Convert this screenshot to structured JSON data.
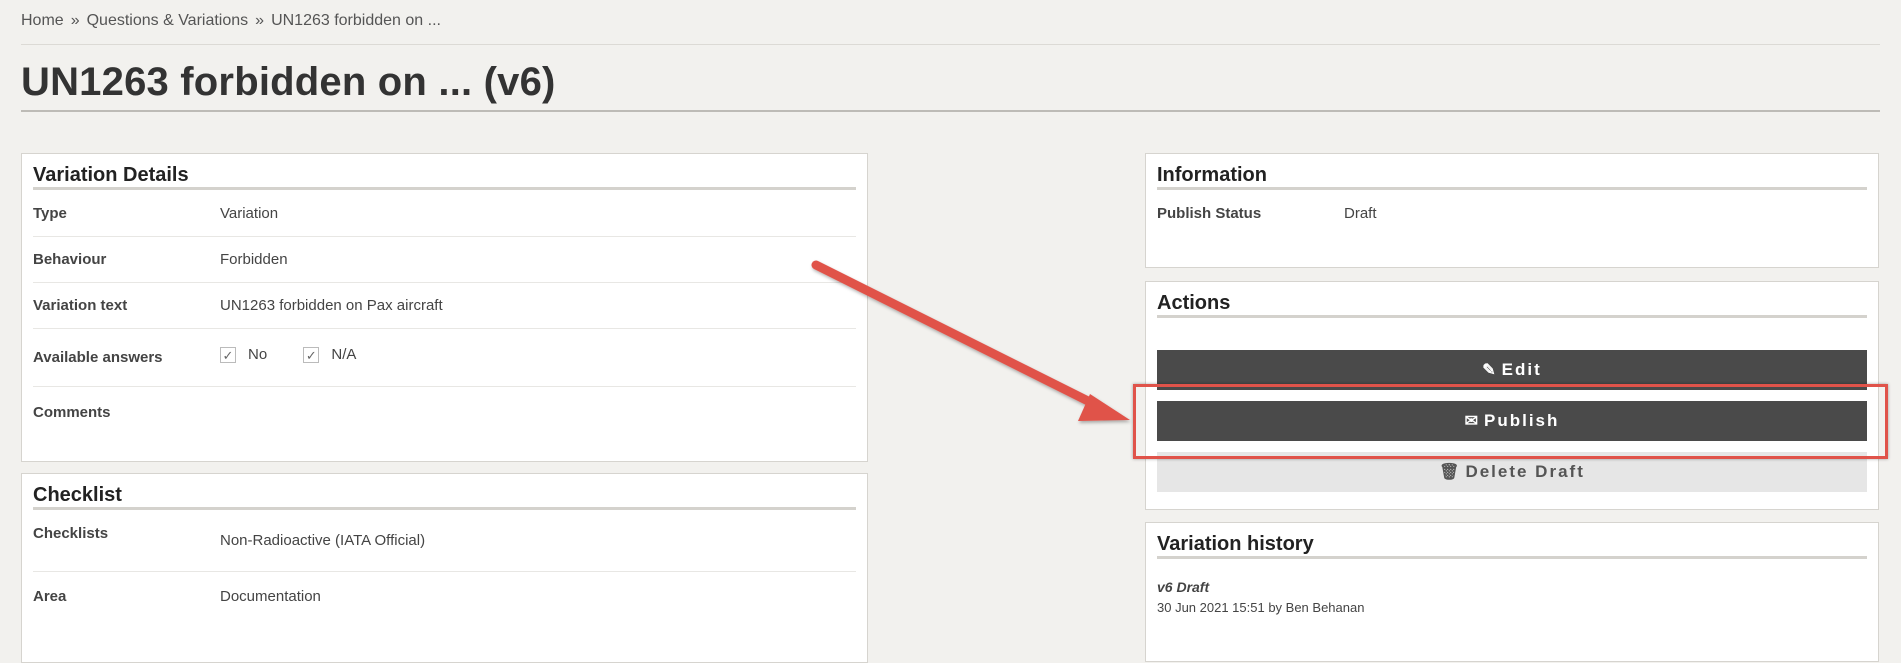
{
  "breadcrumb": {
    "home": "Home",
    "sep": "»",
    "section": "Questions & Variations",
    "current": "UN1263 forbidden on ..."
  },
  "page_title": "UN1263 forbidden on ... (v6)",
  "variation_details": {
    "heading": "Variation Details",
    "type_label": "Type",
    "type_value": "Variation",
    "behaviour_label": "Behaviour",
    "behaviour_value": "Forbidden",
    "text_label": "Variation text",
    "text_value": "UN1263 forbidden on Pax aircraft",
    "answers_label": "Available answers",
    "answers": [
      "No",
      "N/A"
    ],
    "comments_label": "Comments",
    "comments_value": ""
  },
  "checklist": {
    "heading": "Checklist",
    "checklists_label": "Checklists",
    "checklists_value": "Non-Radioactive (IATA Official)",
    "area_label": "Area",
    "area_value": "Documentation"
  },
  "information": {
    "heading": "Information",
    "status_label": "Publish Status",
    "status_value": "Draft"
  },
  "actions": {
    "heading": "Actions",
    "edit_label": "Edit",
    "publish_label": "Publish",
    "delete_label": "Delete Draft"
  },
  "history": {
    "heading": "Variation history",
    "entry_title": "v6 Draft",
    "entry_meta": "30 Jun 2021 15:51 by Ben Behanan"
  },
  "colors": {
    "annotation": "#e0534a",
    "dark_button": "#4a4a4a",
    "light_button": "#e6e6e6",
    "page_bg": "#f2f1ee"
  },
  "icons": {
    "edit": "pencil-icon",
    "publish": "envelope-icon",
    "delete": "trash-icon",
    "check": "checkmark-icon"
  }
}
